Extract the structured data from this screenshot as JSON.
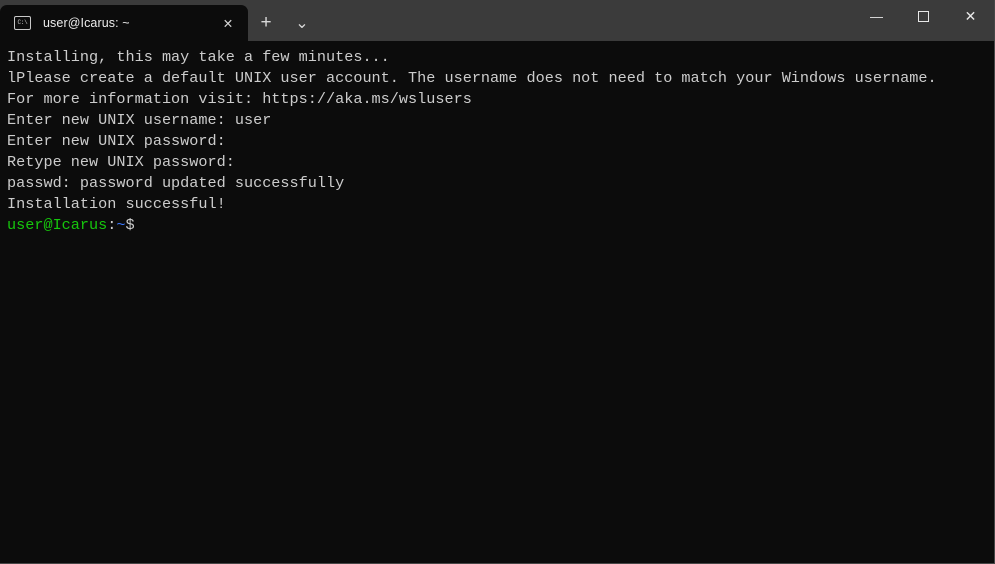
{
  "window": {
    "title": "user@Icarus: ~",
    "background_color": "#0c0c0c",
    "titlebar_color": "#3b3b3b"
  },
  "background_window": {
    "obscured_title": "· · · · · · · · · · · · · ·"
  },
  "tab": {
    "icon_name": "console-cmd-icon",
    "icon_glyph": "C:\\",
    "label": "user@Icarus: ~",
    "close_glyph": "✕"
  },
  "tabbar": {
    "new_tab_glyph": "+",
    "dropdown_glyph": "⌄"
  },
  "window_controls": {
    "minimize_glyph": "—",
    "maximize_glyph": "▢",
    "close_glyph": "✕"
  },
  "terminal": {
    "lines": [
      {
        "segments": [
          {
            "text": "Installing, this may take a few minutes...",
            "color": "white"
          }
        ]
      },
      {
        "segments": [
          {
            "text": "lPlease create a default UNIX user account. The username does not need to match your Windows username.",
            "color": "white"
          }
        ]
      },
      {
        "segments": [
          {
            "text": "For more information visit: https://aka.ms/wslusers",
            "color": "white"
          }
        ]
      },
      {
        "segments": [
          {
            "text": "Enter new UNIX username: user",
            "color": "white"
          }
        ]
      },
      {
        "segments": [
          {
            "text": "Enter new UNIX password:",
            "color": "white"
          }
        ]
      },
      {
        "segments": [
          {
            "text": "Retype new UNIX password:",
            "color": "white"
          }
        ]
      },
      {
        "segments": [
          {
            "text": "passwd: password updated successfully",
            "color": "white"
          }
        ]
      },
      {
        "segments": [
          {
            "text": "Installation successful!",
            "color": "white"
          }
        ]
      },
      {
        "segments": [
          {
            "text": "user@Icarus",
            "color": "green"
          },
          {
            "text": ":",
            "color": "white"
          },
          {
            "text": "~",
            "color": "blue"
          },
          {
            "text": "$",
            "color": "white"
          }
        ]
      }
    ],
    "colors": {
      "foreground": "#cccccc",
      "green": "#16c60c",
      "blue": "#3b78ff",
      "background": "#0c0c0c"
    }
  }
}
